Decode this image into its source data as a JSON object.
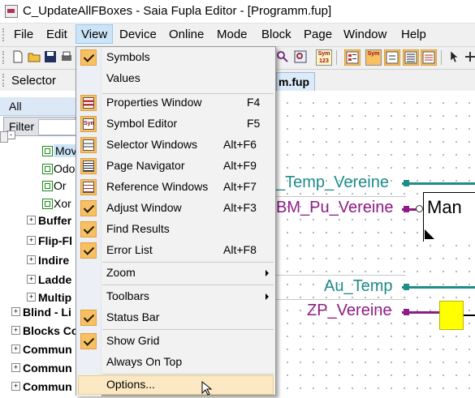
{
  "window": {
    "title": "C_UpdateAllFBoxes - Saia Fupla Editor - [Programm.fup]"
  },
  "menubar": {
    "items": [
      "File",
      "Edit",
      "View",
      "Device",
      "Online",
      "Mode",
      "Block",
      "Page",
      "Window",
      "Help"
    ],
    "active": "View"
  },
  "toolbar": {
    "icon_texts": [
      "Sym 123",
      "Sym",
      "Sym"
    ]
  },
  "selector": {
    "label": "Selector",
    "tab": "m.fup",
    "all": "All",
    "filter": "Filter"
  },
  "tree": {
    "functions": [
      "Mov",
      "Odo",
      "Or",
      "Xor"
    ],
    "groups": [
      "Buffer",
      "Flip-Fl",
      "Indire",
      "Ladde",
      "Multip"
    ],
    "top": [
      "Blind - Li",
      "Blocks Co",
      "Commun",
      "Commun",
      "Commun"
    ]
  },
  "view_menu": {
    "items": [
      {
        "label": "Symbols",
        "checked": true,
        "icon": "check-icon"
      },
      {
        "label": "Values",
        "checked": false
      },
      {
        "sep": true
      },
      {
        "label": "Properties Window",
        "shortcut": "F4",
        "icon": "properties-window-icon"
      },
      {
        "label": "Symbol Editor",
        "shortcut": "F5",
        "icon": "symbol-editor-icon",
        "icon_text": "Sym"
      },
      {
        "label": "Selector Windows",
        "shortcut": "Alt+F6",
        "icon": "selector-windows-icon"
      },
      {
        "label": "Page Navigator",
        "shortcut": "Alt+F9",
        "icon": "page-navigator-icon"
      },
      {
        "label": "Reference Windows",
        "shortcut": "Alt+F7",
        "icon": "reference-windows-icon"
      },
      {
        "label": "Adjust Window",
        "shortcut": "Alt+F3",
        "checked": true
      },
      {
        "label": "Find Results",
        "checked": true
      },
      {
        "label": "Error List",
        "shortcut": "Alt+F8",
        "checked": true
      },
      {
        "sep": true
      },
      {
        "label": "Zoom",
        "submenu": true
      },
      {
        "sep": true
      },
      {
        "label": "Toolbars",
        "submenu": true
      },
      {
        "label": "Status Bar",
        "checked": true
      },
      {
        "sep": true
      },
      {
        "label": "Show Grid",
        "checked": true
      },
      {
        "label": "Always On Top"
      },
      {
        "sep": true
      },
      {
        "label": "Options...",
        "highlighted": true
      }
    ]
  },
  "canvas": {
    "signals": [
      {
        "text": "_Temp_Vereine",
        "color": "#1e8c88"
      },
      {
        "text": "BM_Pu_Vereine",
        "color": "#8e1c86"
      },
      {
        "text": "Au_Temp",
        "color": "#1e8c88"
      },
      {
        "text": "ZP_Vereine",
        "color": "#8e1c86"
      }
    ],
    "block_label": "Man",
    "block_color": "#ffff00"
  },
  "colors": {
    "accent_check": "#f8c060",
    "menu_highlight": "#fce9c3",
    "menubar_active": "#cce4f7"
  }
}
